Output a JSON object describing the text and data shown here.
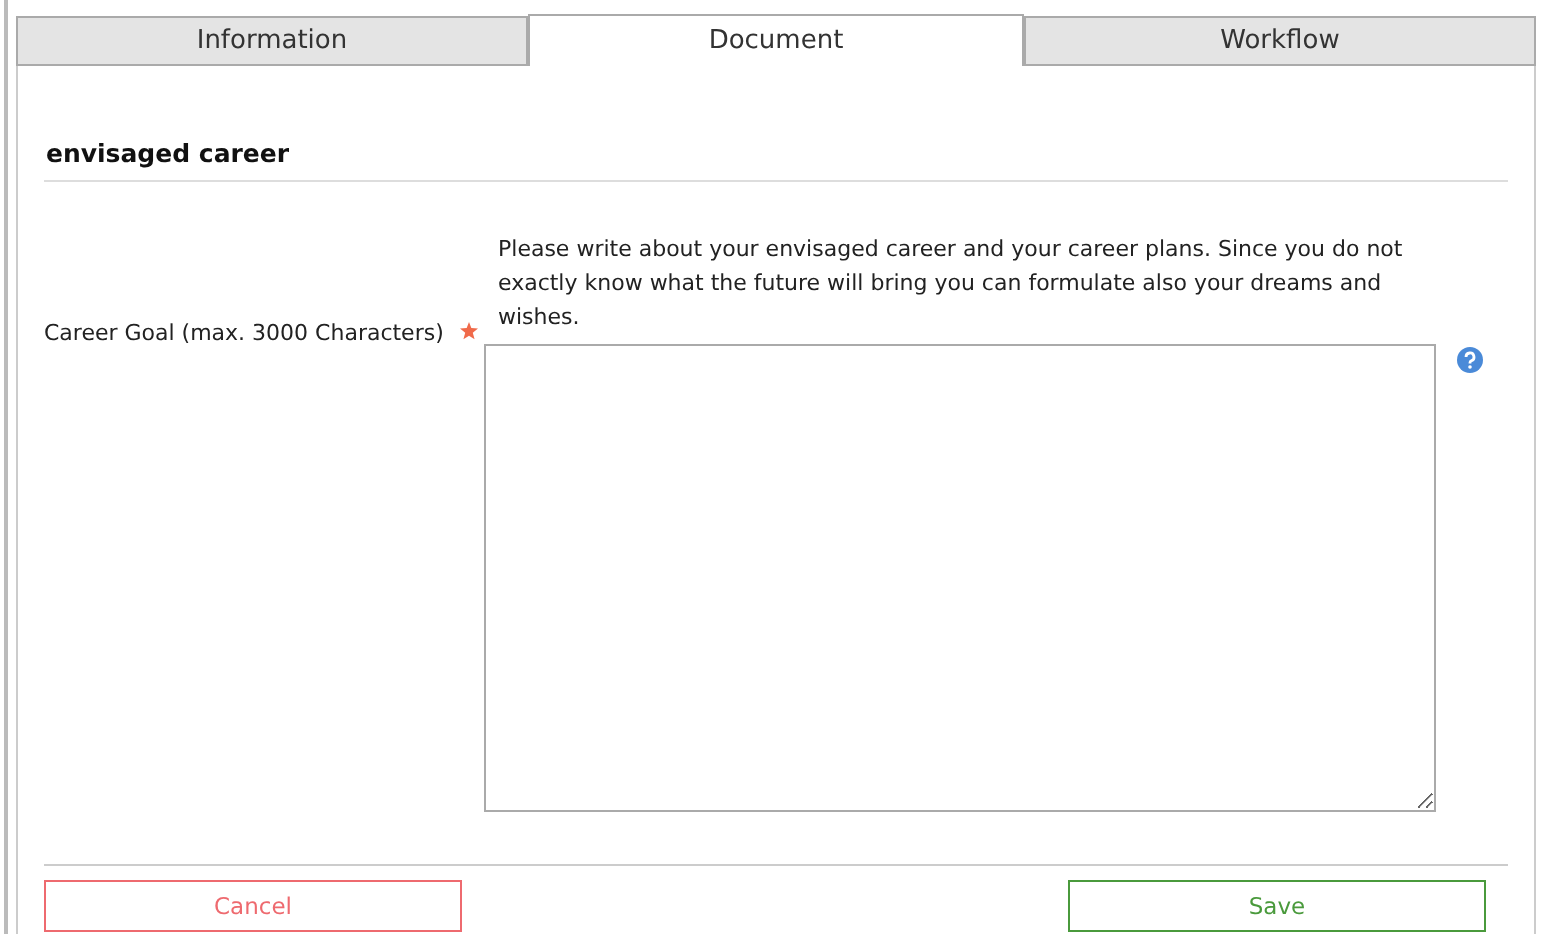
{
  "tabs": [
    {
      "label": "Information",
      "selected": false
    },
    {
      "label": "Document",
      "selected": true
    },
    {
      "label": "Workflow",
      "selected": false
    }
  ],
  "section": {
    "title": "envisaged career"
  },
  "field": {
    "hint": "Please write about your envisaged career and your career plans. Since you do not exactly know what the future will bring you can formulate also your dreams and wishes.",
    "label": "Career Goal (max. 3000 Characters)",
    "required": true
  },
  "buttons": [
    {
      "label": "Cancel",
      "kind": "cancel"
    },
    {
      "label": "Save",
      "kind": "save"
    }
  ]
}
